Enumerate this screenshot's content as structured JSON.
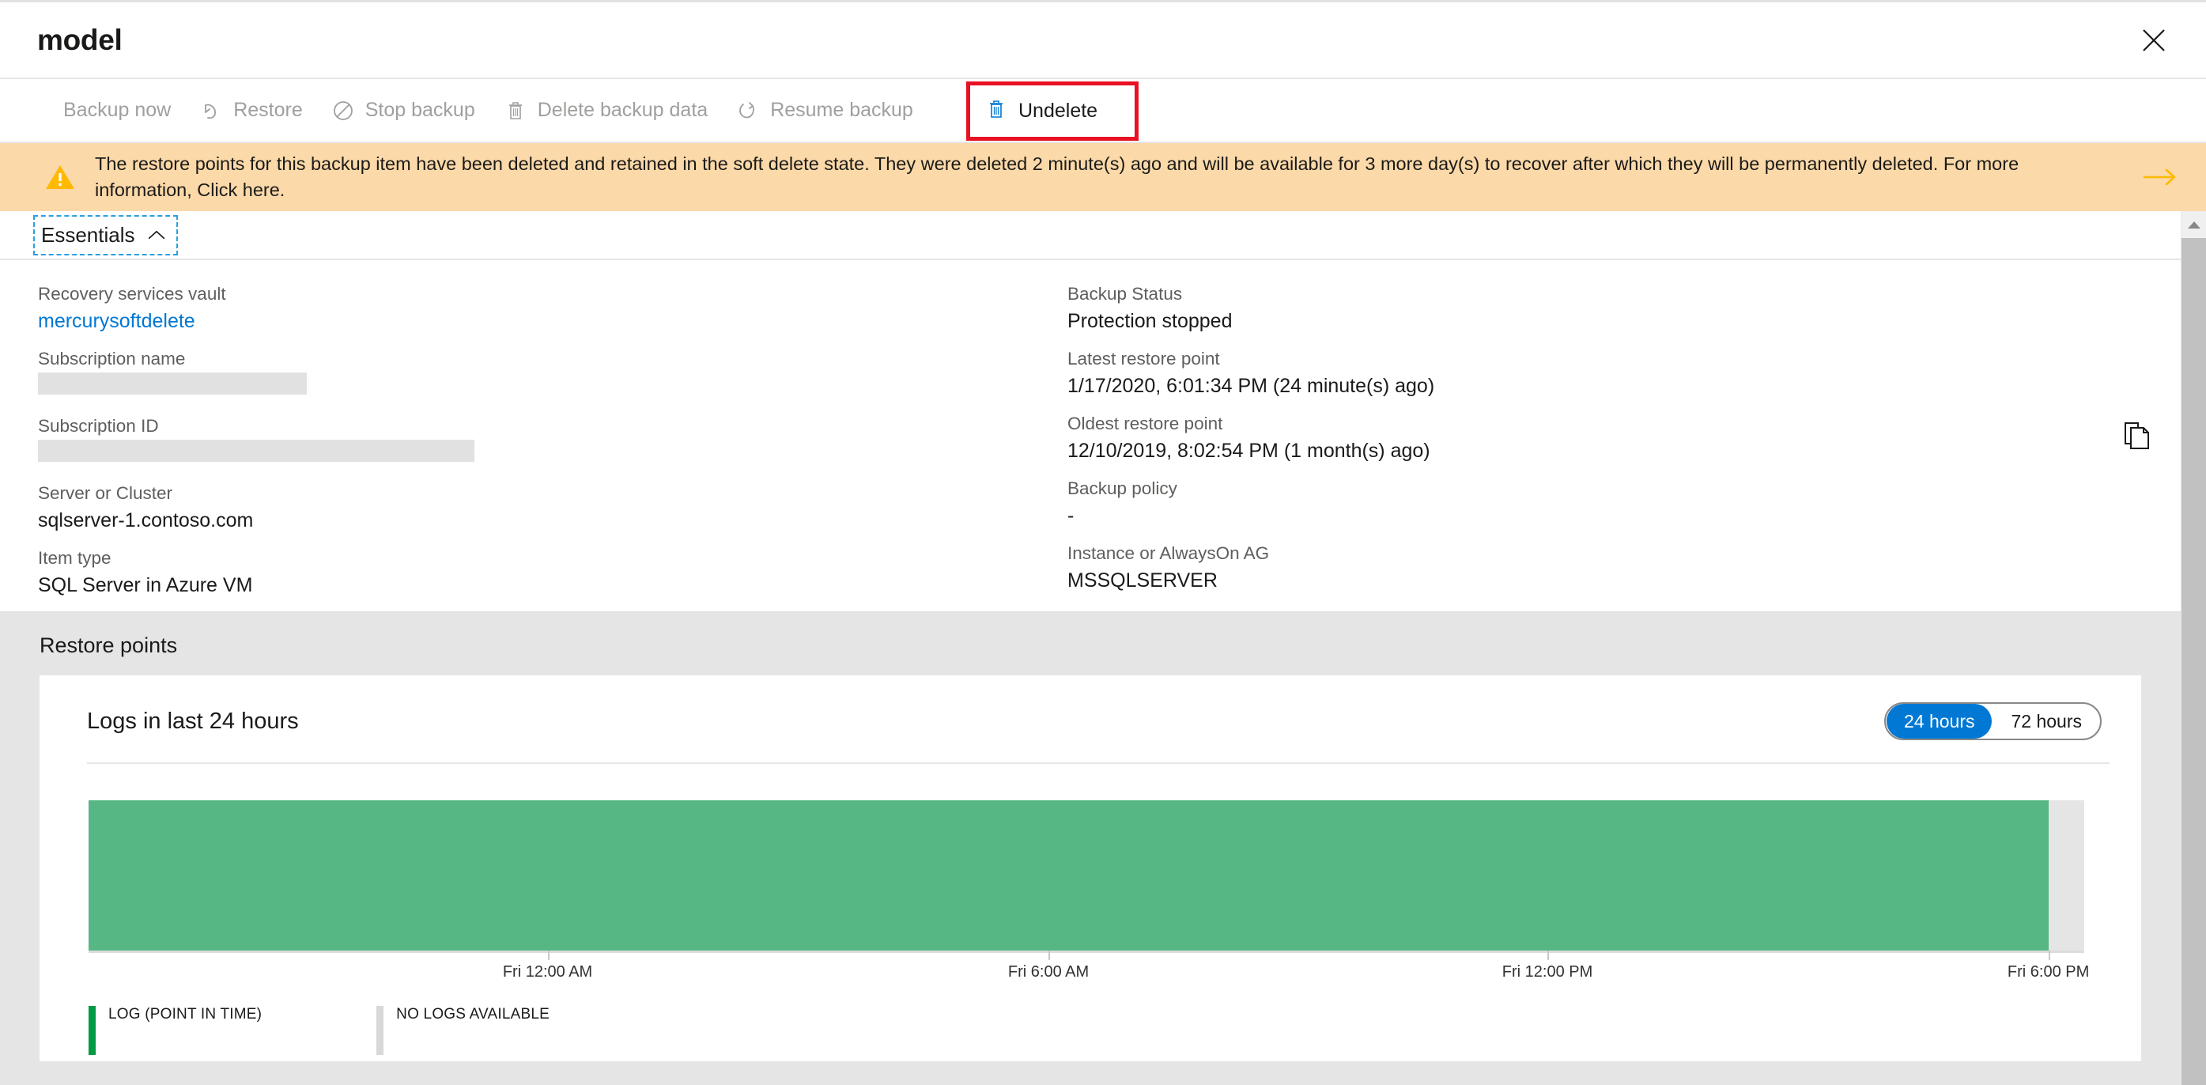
{
  "blade": {
    "title": "model",
    "close_icon": "close-icon"
  },
  "commandbar": {
    "items": [
      {
        "label": "Backup now",
        "icon": "none",
        "enabled": false
      },
      {
        "label": "Restore",
        "icon": "restore-icon",
        "enabled": false
      },
      {
        "label": "Stop backup",
        "icon": "stop-backup-icon",
        "enabled": false
      },
      {
        "label": "Delete backup data",
        "icon": "trash-icon",
        "enabled": false
      },
      {
        "label": "Resume backup",
        "icon": "resume-icon",
        "enabled": false
      }
    ],
    "undelete": {
      "label": "Undelete",
      "icon": "trash-blue-icon",
      "enabled": true,
      "highlighted": true
    },
    "highlight_color": "#e81123"
  },
  "banner": {
    "icon": "warning-icon",
    "text": "The restore points for this backup item have been deleted and retained in the soft delete state. They were deleted 2 minute(s) ago and will be available for 3 more day(s) to recover after which they will be permanently deleted. For more information, Click here.",
    "arrow_icon": "arrow-right-icon",
    "background": "#fbd9a8",
    "icon_color": "#ffb900"
  },
  "essentials": {
    "header": "Essentials",
    "collapse_icon": "chevron-up-icon",
    "left": [
      {
        "key": "Recovery services vault",
        "value": "mercurysoftdelete",
        "type": "link"
      },
      {
        "key": "Subscription name",
        "value": "",
        "type": "redacted-1"
      },
      {
        "key": "Subscription ID",
        "value": "",
        "type": "redacted-2"
      },
      {
        "key": "Server or Cluster",
        "value": "sqlserver-1.contoso.com",
        "type": "text"
      },
      {
        "key": "Item type",
        "value": "SQL Server in Azure VM",
        "type": "text"
      }
    ],
    "right": [
      {
        "key": "Backup Status",
        "value": "Protection stopped"
      },
      {
        "key": "Latest restore point",
        "value": "1/17/2020, 6:01:34 PM (24 minute(s) ago)"
      },
      {
        "key": "Oldest restore point",
        "value": "12/10/2019, 8:02:54 PM (1 month(s) ago)"
      },
      {
        "key": "Backup policy",
        "value": "-"
      },
      {
        "key": "Instance or AlwaysOn AG",
        "value": "MSSQLSERVER"
      }
    ],
    "copy_icon": "copy-icon",
    "link_color": "#0078d4"
  },
  "restore_points": {
    "section_title": "Restore points",
    "chart_title": "Logs in last 24 hours",
    "range_options": [
      {
        "label": "24 hours",
        "selected": true
      },
      {
        "label": "72 hours",
        "selected": false
      }
    ]
  },
  "chart_data": {
    "type": "bar",
    "title": "Logs in last 24 hours",
    "xlabel": "",
    "ylabel": "",
    "categories": [
      "Fri 12:00 AM",
      "Fri 6:00 AM",
      "Fri 12:00 PM",
      "Fri 6:00 PM"
    ],
    "tick_labels": [
      "Fri 12:00 AM",
      "Fri 6:00 AM",
      "Fri 6:00 PM",
      "Fri 12:00 PM"
    ],
    "axis_ticks": [
      {
        "label": "Fri 12:00 AM",
        "position_pct": 23.0
      },
      {
        "label": "Fri 6:00 AM",
        "position_pct": 48.1
      },
      {
        "label": "Fri 12:00 PM",
        "position_pct": 73.1
      },
      {
        "label": "Fri 6:00 PM",
        "position_pct": 98.2
      }
    ],
    "segments": [
      {
        "name": "LOG (POINT IN TIME)",
        "color": "#57b784",
        "width_pct": 98.2,
        "value": 1
      },
      {
        "name": "NO LOGS AVAILABLE",
        "color": "#e5e5e5",
        "width_pct": 1.8,
        "value": 0
      }
    ],
    "legend": [
      {
        "label": "LOG (POINT IN TIME)",
        "color": "#009a44"
      },
      {
        "label": "NO LOGS AVAILABLE",
        "color": "#d8d8d8"
      }
    ],
    "legend_position": "bottom-left",
    "grid": false
  },
  "scrollbar": {
    "up_arrow_icon": "triangle-up-icon"
  }
}
